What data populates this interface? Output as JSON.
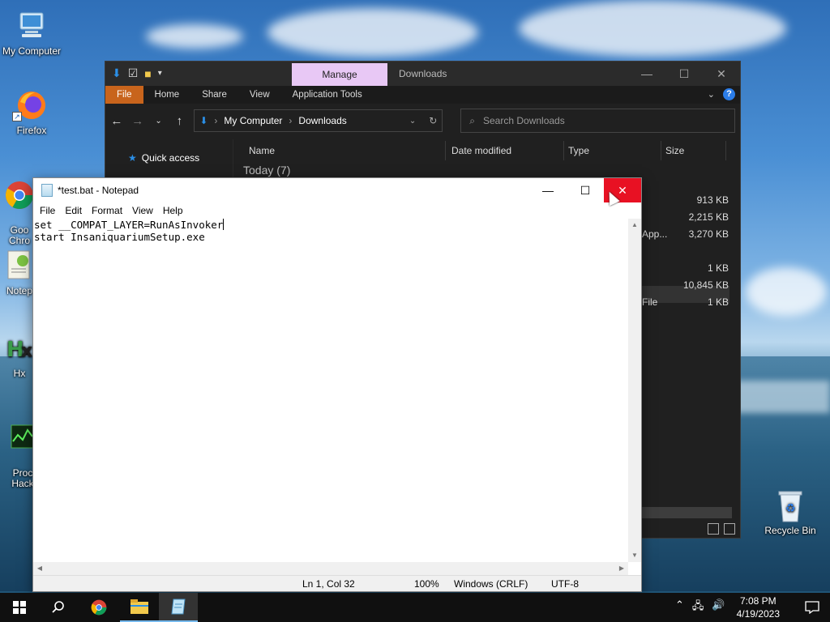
{
  "desktop": {
    "icons": [
      {
        "label": "My Computer"
      },
      {
        "label": "Firefox"
      },
      {
        "label": "Goo\nChro"
      },
      {
        "label": "Notep"
      },
      {
        "label": "Hx"
      },
      {
        "label": "Proc\nHack"
      },
      {
        "label": "Recycle Bin"
      }
    ]
  },
  "explorer": {
    "manage_tab": "Manage",
    "title": "Downloads",
    "ribbon_tabs": [
      "File",
      "Home",
      "Share",
      "View",
      "Application Tools"
    ],
    "breadcrumb": [
      "My Computer",
      "Downloads"
    ],
    "search_placeholder": "Search Downloads",
    "nav_quick_access": "Quick access",
    "columns": [
      "Name",
      "Date modified",
      "Type",
      "Size"
    ],
    "group_header": "Today (7)",
    "visible_type_fragments": [
      "App...",
      "File"
    ],
    "sizes": [
      "913 KB",
      "2,215 KB",
      "3,270 KB",
      "1 KB",
      "10,845 KB",
      "1 KB"
    ]
  },
  "notepad": {
    "title": "*test.bat - Notepad",
    "menu": [
      "File",
      "Edit",
      "Format",
      "View",
      "Help"
    ],
    "lines": [
      "set __COMPAT_LAYER=RunAsInvoker",
      "start InsaniquariumSetup.exe"
    ],
    "status": {
      "position": "Ln 1, Col 32",
      "zoom": "100%",
      "line_endings": "Windows (CRLF)",
      "encoding": "UTF-8"
    }
  },
  "taskbar": {
    "time": "7:08 PM",
    "date": "4/19/2023"
  }
}
